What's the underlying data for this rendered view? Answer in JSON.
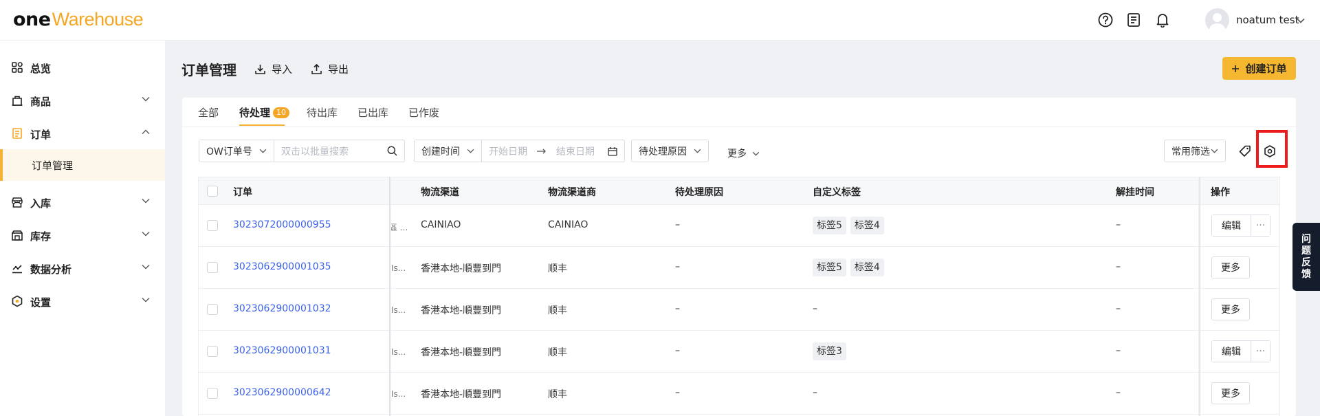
{
  "header": {
    "logo_one": "one",
    "logo_warehouse": "Warehouse",
    "username": "noatum test"
  },
  "sidebar": {
    "items": [
      {
        "label": "总览",
        "icon": "dashboard-icon"
      },
      {
        "label": "商品",
        "icon": "product-icon"
      },
      {
        "label": "订单",
        "icon": "order-icon"
      },
      {
        "label": "入库",
        "icon": "inbound-icon"
      },
      {
        "label": "库存",
        "icon": "inventory-icon"
      },
      {
        "label": "数据分析",
        "icon": "analytics-icon"
      },
      {
        "label": "设置",
        "icon": "settings-icon"
      }
    ],
    "sub_item": "订单管理"
  },
  "main": {
    "title": "订单管理",
    "import_label": "导入",
    "export_label": "导出",
    "create_label": "创建订单",
    "tabs": [
      {
        "label": "全部"
      },
      {
        "label": "待处理",
        "badge": "10"
      },
      {
        "label": "待出库"
      },
      {
        "label": "已出库"
      },
      {
        "label": "已作废"
      }
    ]
  },
  "filters": {
    "order_type": "OW订单号",
    "search_placeholder": "双击以批量搜索",
    "time_type": "创建时间",
    "start_placeholder": "开始日期",
    "end_placeholder": "结束日期",
    "reason": "待处理原因",
    "more": "更多",
    "common_filter": "常用筛选"
  },
  "table": {
    "columns": {
      "order": "订单",
      "channel": "物流渠道",
      "carrier": "物流渠道商",
      "reason": "待处理原因",
      "tags": "自定义标签",
      "unhold_time": "解挂时间",
      "actions": "操作"
    },
    "rows": [
      {
        "order": "3023072000000955",
        "trunc": "區 ...",
        "channel": "CAINIAO",
        "carrier": "CAINIAO",
        "reason": "–",
        "tags": [
          "标签5",
          "标签4"
        ],
        "tag_empty": "",
        "unhold": "–",
        "action": "编辑",
        "action_more": "···"
      },
      {
        "order": "3023062900001035",
        "trunc": "Is...",
        "channel": "香港本地-順豐到門",
        "carrier": "顺丰",
        "reason": "–",
        "tags": [
          "标签5",
          "标签4"
        ],
        "tag_empty": "",
        "unhold": "–",
        "action": "更多"
      },
      {
        "order": "3023062900001032",
        "trunc": "Is...",
        "channel": "香港本地-順豐到門",
        "carrier": "顺丰",
        "reason": "–",
        "tags": [],
        "tag_empty": "–",
        "unhold": "–",
        "action": "更多"
      },
      {
        "order": "3023062900001031",
        "trunc": "Is...",
        "channel": "香港本地-順豐到門",
        "carrier": "顺丰",
        "reason": "–",
        "tags": [
          "标签3"
        ],
        "tag_empty": "",
        "unhold": "–",
        "action": "编辑",
        "action_more": "···"
      },
      {
        "order": "3023062900000642",
        "trunc": "Is...",
        "channel": "香港本地-順豐到門",
        "carrier": "顺丰",
        "reason": "–",
        "tags": [],
        "tag_empty": "–",
        "unhold": "–",
        "action": "更多"
      }
    ]
  },
  "feedback": [
    "问",
    "题",
    "反",
    "馈"
  ],
  "colors": {
    "accent": "#f5b72f",
    "link": "#3c62e8",
    "highlight": "#ec1c1c",
    "feedback_bg": "#151c2c"
  }
}
